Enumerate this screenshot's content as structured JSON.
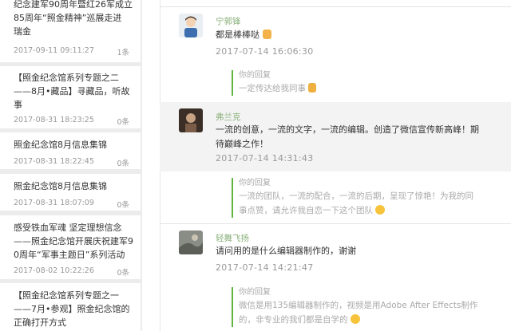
{
  "list": [
    {
      "title_lines": [
        "纪念建军90周年暨红26军成立",
        "85周年“照金精神”巡展走进",
        "瑞金"
      ],
      "date": "2017-09-11 09:11:27",
      "count": "1条"
    },
    {
      "title_lines": [
        "【照金纪念馆系列专题之二",
        "——8月•藏品】寻藏品，听故",
        "事"
      ],
      "date": "2017-08-31 18:23:25",
      "count": "0条"
    },
    {
      "title_lines": [
        "照金纪念馆8月信息集锦"
      ],
      "date": "2017-08-31 18:22:45",
      "count": "0条"
    },
    {
      "title_lines": [
        "照金纪念馆8月信息集锦"
      ],
      "date": "2017-08-31 18:07:09",
      "count": "0条"
    },
    {
      "title_lines": [
        "感受铁血军魂 坚定理想信念",
        "——照金纪念馆开展庆祝建军9",
        "0周年“军事主题日”系列活动"
      ],
      "date": "2017-08-02 10:22:26",
      "count": "0条"
    },
    {
      "title_lines": [
        "【照金纪念馆系列专题之一",
        "——7月•参观】照金纪念馆的",
        "正确打开方式"
      ],
      "date": "",
      "count": ""
    }
  ],
  "comments": [
    {
      "user": "宁郭锋",
      "message": "都是棒棒哒",
      "time": "2017-07-14 16:06:30",
      "reply_label": "你的回复",
      "reply": "一定传达给我同事"
    },
    {
      "user": "弗兰克",
      "message": "一流的创意，一流的文字，一流的编辑。创造了微信宣传新高峰！期待巅峰之作！",
      "time": "2017-07-14 14:31:43",
      "reply_label": "你的回复",
      "reply": "一流的团队，一流的配合，一流的后期，呈现了惊艳！为我的同事点赞，请允许我自恋一下这个团队"
    },
    {
      "user": "轻舞飞扬",
      "message": "请问用的是什么编辑器制作的，谢谢",
      "time": "2017-07-14 14:21:47",
      "reply_label": "你的回复",
      "reply": "微信是用135编辑器制作的，视频是用Adobe After Effects制作的，非专业的我们都是自学的"
    }
  ]
}
